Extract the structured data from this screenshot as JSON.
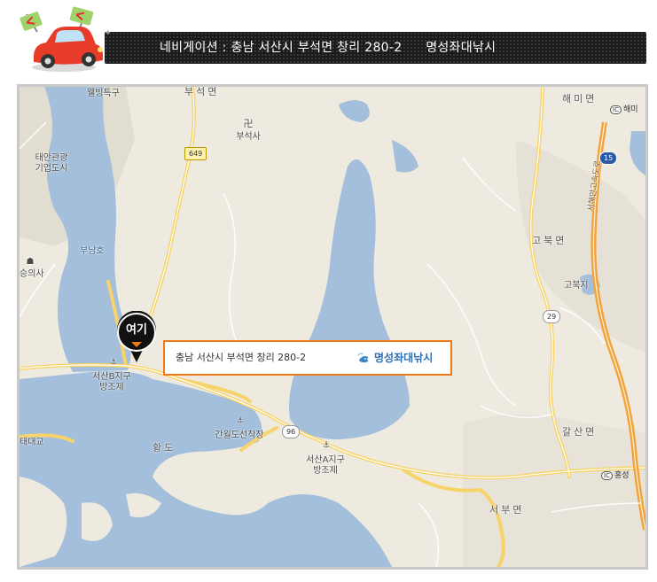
{
  "header": {
    "navigation_label": "네비게이션 :",
    "address": "충남 서산시 부석면 창리 280-2",
    "place_name": "명성좌대낚시"
  },
  "marker": {
    "label": "여기"
  },
  "info_box": {
    "address": "충남 서산시 부석면 창리 280-2",
    "logo_text": "명성좌대낚시"
  },
  "map_labels": {
    "welbing": "웰빙특구",
    "buseok_top": "부석면",
    "buseoksa_symbol": "卍",
    "buseoksa": "부석사",
    "haemi_top": "해미면",
    "haemi_ic": "해미",
    "taean_1": "태안관광",
    "taean_2": "기업도시",
    "bunamho": "부남호",
    "ganwol_symbol": "☗",
    "ganwol": "승의사",
    "gobuk_myeon": "고북면",
    "gobuk_ji": "고북지",
    "seosan_b_1": "서산B지구",
    "seosan_b_2": "방조제",
    "hwangdo": "황도",
    "ganwoldo": "간월도선착장",
    "seosan_a_1": "서산A지구",
    "seosan_a_2": "방조제",
    "galsan": "갈산면",
    "hongseong_ic": "홍성",
    "seobu": "서부면",
    "daegyo": "태대교",
    "expressway": "서해안고속도로",
    "ic_label": "IC"
  },
  "route_shields": {
    "r649": "649",
    "r15": "15",
    "r29": "29",
    "r96": "96"
  },
  "colors": {
    "water": "#a3bfdc",
    "land": "#eeeae0",
    "road_yellow": "#f7d36a",
    "expressway": "#f3a33b",
    "info_border": "#f07a1a",
    "header_bg": "#1a1a1a"
  }
}
